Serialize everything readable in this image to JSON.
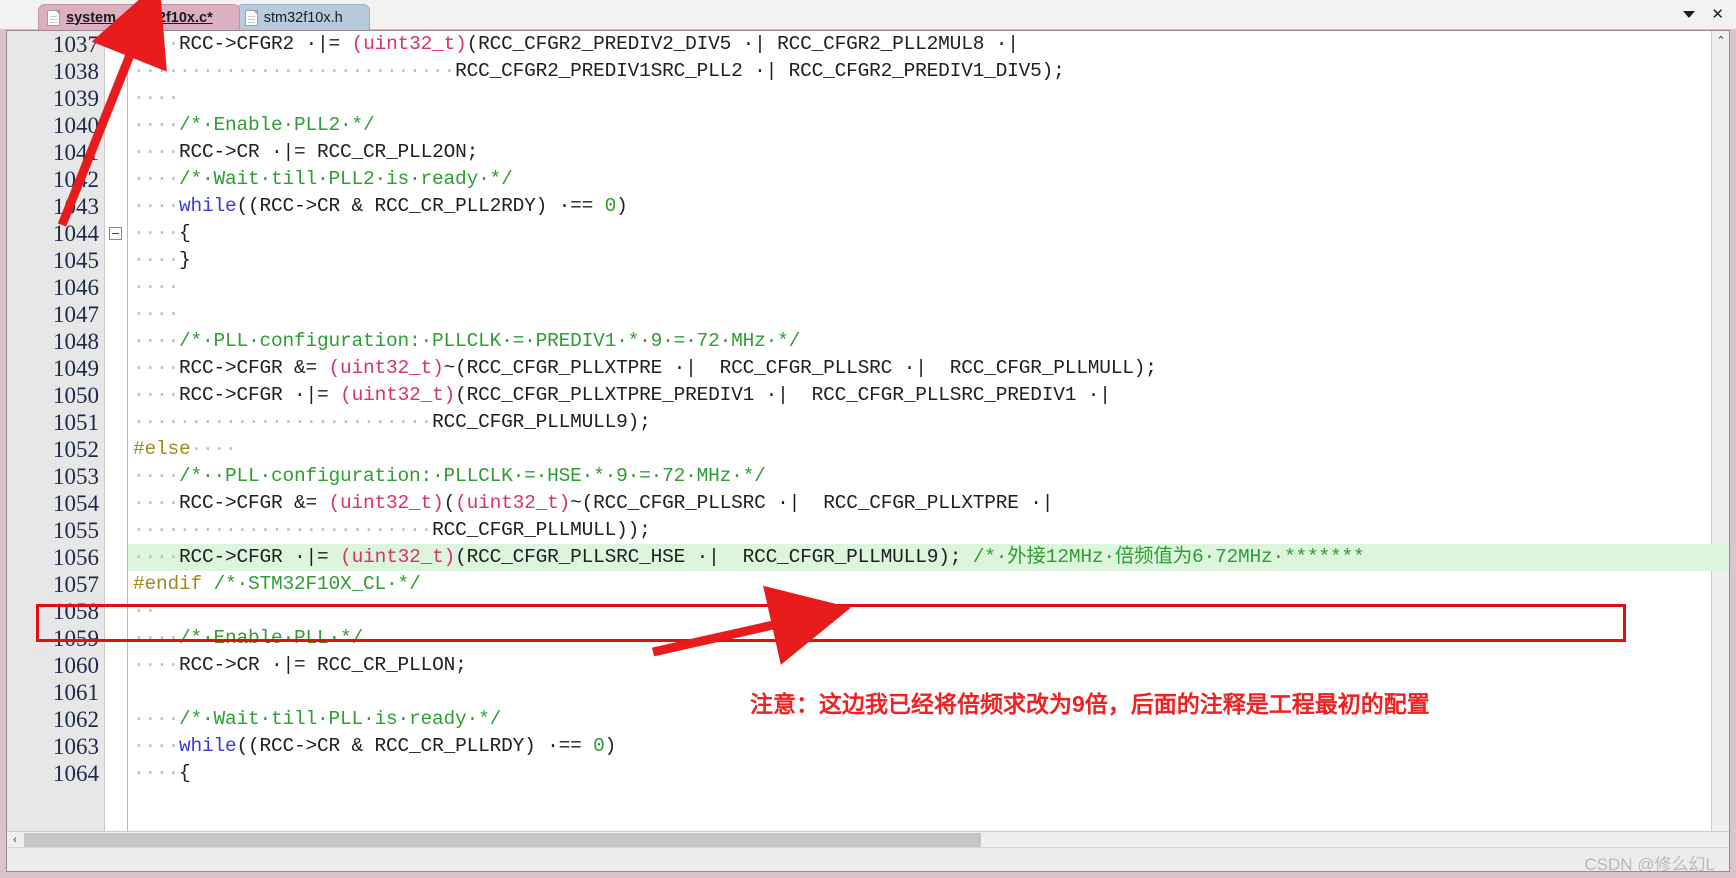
{
  "window": {
    "controls": [
      {
        "name": "dropdown",
        "icon": "caret-down-icon",
        "label": "▾"
      },
      {
        "name": "close",
        "icon": "close-icon",
        "label": "✕"
      }
    ]
  },
  "tabs": [
    {
      "label": "system_stm32f10x.c*",
      "active": true,
      "icon": "document-icon"
    },
    {
      "label": "stm32f10x.h",
      "active": false,
      "icon": "document-icon"
    }
  ],
  "editor": {
    "first_line": 1037,
    "fold_line": 1044,
    "highlight_line": 1056,
    "lines": [
      {
        "num": "1037",
        "segments": [
          {
            "t": "····",
            "c": "dot"
          },
          {
            "t": "RCC->CFGR2 ",
            "c": "op"
          },
          {
            "t": "·|= ",
            "c": "op"
          },
          {
            "t": "(uint32_t)",
            "c": "type"
          },
          {
            "t": "(RCC_CFGR2_PREDIV2_DIV5 ",
            "c": "op"
          },
          {
            "t": "·|",
            "c": "op"
          },
          {
            "t": " RCC_CFGR2_PLL2MUL8 ",
            "c": "op"
          },
          {
            "t": "·|",
            "c": "op"
          }
        ]
      },
      {
        "num": "1038",
        "segments": [
          {
            "t": "····························",
            "c": "dot"
          },
          {
            "t": "RCC_CFGR2_PREDIV1SRC_PLL2 ",
            "c": "op"
          },
          {
            "t": "·|",
            "c": "op"
          },
          {
            "t": " RCC_CFGR2_PREDIV1_DIV5);",
            "c": "op"
          }
        ]
      },
      {
        "num": "1039",
        "segments": [
          {
            "t": "····",
            "c": "dot"
          }
        ]
      },
      {
        "num": "1040",
        "segments": [
          {
            "t": "····",
            "c": "dot"
          },
          {
            "t": "/*·Enable·PLL2·*/",
            "c": "cmt"
          }
        ]
      },
      {
        "num": "1041",
        "segments": [
          {
            "t": "····",
            "c": "dot"
          },
          {
            "t": "RCC->CR ",
            "c": "op"
          },
          {
            "t": "·|= ",
            "c": "op"
          },
          {
            "t": "RCC_CR_PLL2ON;",
            "c": "op"
          }
        ]
      },
      {
        "num": "1042",
        "segments": [
          {
            "t": "····",
            "c": "dot"
          },
          {
            "t": "/*·Wait·till·PLL2·is·ready·*/",
            "c": "cmt"
          }
        ]
      },
      {
        "num": "1043",
        "segments": [
          {
            "t": "····",
            "c": "dot"
          },
          {
            "t": "while",
            "c": "kw"
          },
          {
            "t": "((RCC->CR & RCC_CR_PLL2RDY) ",
            "c": "op"
          },
          {
            "t": "·== ",
            "c": "op"
          },
          {
            "t": "0",
            "c": "num"
          },
          {
            "t": ")",
            "c": "op"
          }
        ]
      },
      {
        "num": "1044",
        "segments": [
          {
            "t": "····",
            "c": "dot"
          },
          {
            "t": "{",
            "c": "op"
          }
        ]
      },
      {
        "num": "1045",
        "segments": [
          {
            "t": "····",
            "c": "dot"
          },
          {
            "t": "}",
            "c": "op"
          }
        ]
      },
      {
        "num": "1046",
        "segments": [
          {
            "t": "····",
            "c": "dot"
          }
        ]
      },
      {
        "num": "1047",
        "segments": [
          {
            "t": "····",
            "c": "dot"
          }
        ]
      },
      {
        "num": "1048",
        "segments": [
          {
            "t": "····",
            "c": "dot"
          },
          {
            "t": "/*·PLL·configuration:·PLLCLK·=·PREDIV1·*·9·=·72·MHz·*/",
            "c": "cmt"
          }
        ]
      },
      {
        "num": "1049",
        "segments": [
          {
            "t": "····",
            "c": "dot"
          },
          {
            "t": "RCC->CFGR &= ",
            "c": "op"
          },
          {
            "t": "(uint32_t)",
            "c": "type"
          },
          {
            "t": "~(RCC_CFGR_PLLXTPRE ",
            "c": "op"
          },
          {
            "t": "·|",
            "c": "op"
          },
          {
            "t": "  RCC_CFGR_PLLSRC ",
            "c": "op"
          },
          {
            "t": "·|",
            "c": "op"
          },
          {
            "t": "  RCC_CFGR_PLLMULL);",
            "c": "op"
          }
        ]
      },
      {
        "num": "1050",
        "segments": [
          {
            "t": "····",
            "c": "dot"
          },
          {
            "t": "RCC->CFGR ",
            "c": "op"
          },
          {
            "t": "·|= ",
            "c": "op"
          },
          {
            "t": "(uint32_t)",
            "c": "type"
          },
          {
            "t": "(RCC_CFGR_PLLXTPRE_PREDIV1 ",
            "c": "op"
          },
          {
            "t": "·|",
            "c": "op"
          },
          {
            "t": "  RCC_CFGR_PLLSRC_PREDIV1 ",
            "c": "op"
          },
          {
            "t": "·|",
            "c": "op"
          }
        ]
      },
      {
        "num": "1051",
        "segments": [
          {
            "t": "··························",
            "c": "dot"
          },
          {
            "t": "RCC_CFGR_PLLMULL9);",
            "c": "op"
          }
        ]
      },
      {
        "num": "1052",
        "segments": [
          {
            "t": "#else",
            "c": "pp"
          },
          {
            "t": "····",
            "c": "dot"
          }
        ]
      },
      {
        "num": "1053",
        "segments": [
          {
            "t": "····",
            "c": "dot"
          },
          {
            "t": "/*··PLL·configuration:·PLLCLK·=·HSE·*·9·=·72·MHz·*/",
            "c": "cmt"
          }
        ]
      },
      {
        "num": "1054",
        "segments": [
          {
            "t": "····",
            "c": "dot"
          },
          {
            "t": "RCC->CFGR &= ",
            "c": "op"
          },
          {
            "t": "(uint32_t)",
            "c": "type"
          },
          {
            "t": "(",
            "c": "op"
          },
          {
            "t": "(uint32_t)",
            "c": "type"
          },
          {
            "t": "~(RCC_CFGR_PLLSRC ",
            "c": "op"
          },
          {
            "t": "·|",
            "c": "op"
          },
          {
            "t": "  RCC_CFGR_PLLXTPRE ",
            "c": "op"
          },
          {
            "t": "·|",
            "c": "op"
          }
        ]
      },
      {
        "num": "1055",
        "segments": [
          {
            "t": "··························",
            "c": "dot"
          },
          {
            "t": "RCC_CFGR_PLLMULL));",
            "c": "op"
          }
        ]
      },
      {
        "num": "1056",
        "highlight": true,
        "segments": [
          {
            "t": "····",
            "c": "dot"
          },
          {
            "t": "RCC->CFGR ",
            "c": "op"
          },
          {
            "t": "·|= ",
            "c": "op"
          },
          {
            "t": "(uint32_t)",
            "c": "type"
          },
          {
            "t": "(RCC_CFGR_PLLSRC_HSE ",
            "c": "op"
          },
          {
            "t": "·|",
            "c": "op"
          },
          {
            "t": "  RCC_CFGR_PLLMULL9); ",
            "c": "op"
          },
          {
            "t": "/*·外接12MHz·倍频值为6·72MHz·*******",
            "c": "cmt"
          }
        ]
      },
      {
        "num": "1057",
        "segments": [
          {
            "t": "#endif",
            "c": "pp"
          },
          {
            "t": " ",
            "c": "op"
          },
          {
            "t": "/*·STM32F10X_CL·*/",
            "c": "cmt"
          }
        ]
      },
      {
        "num": "1058",
        "segments": [
          {
            "t": "··",
            "c": "dot"
          }
        ]
      },
      {
        "num": "1059",
        "segments": [
          {
            "t": "····",
            "c": "dot"
          },
          {
            "t": "/*·Enable·PLL·*/",
            "c": "cmt"
          }
        ]
      },
      {
        "num": "1060",
        "segments": [
          {
            "t": "····",
            "c": "dot"
          },
          {
            "t": "RCC->CR ",
            "c": "op"
          },
          {
            "t": "·|= ",
            "c": "op"
          },
          {
            "t": "RCC_CR_PLLON;",
            "c": "op"
          }
        ]
      },
      {
        "num": "1061",
        "segments": []
      },
      {
        "num": "1062",
        "segments": [
          {
            "t": "····",
            "c": "dot"
          },
          {
            "t": "/*·Wait·till·PLL·is·ready·*/",
            "c": "cmt"
          }
        ]
      },
      {
        "num": "1063",
        "segments": [
          {
            "t": "····",
            "c": "dot"
          },
          {
            "t": "while",
            "c": "kw"
          },
          {
            "t": "((RCC->CR & RCC_CR_PLLRDY) ",
            "c": "op"
          },
          {
            "t": "·== ",
            "c": "op"
          },
          {
            "t": "0",
            "c": "num"
          },
          {
            "t": ")",
            "c": "op"
          }
        ]
      },
      {
        "num": "1064",
        "segments": [
          {
            "t": "····",
            "c": "dot"
          },
          {
            "t": "{",
            "c": "op"
          }
        ]
      }
    ]
  },
  "annotation": {
    "note_text": "注意：这边我已经将倍频求改为9倍，后面的注释是工程最初的配置",
    "box_color": "#e01010",
    "arrow_color": "#e81c1c"
  },
  "scrollbars": {
    "vertical_up": "⌃",
    "vertical_down": "⌄",
    "horizontal_left": "‹"
  },
  "status": {
    "watermark": "CSDN @修么幻L"
  }
}
